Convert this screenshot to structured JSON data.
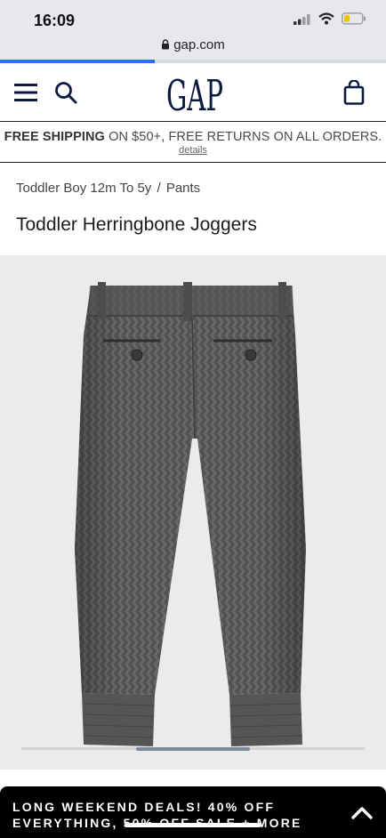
{
  "status_bar": {
    "time": "16:09",
    "icons": [
      "signal-icon",
      "wifi-icon",
      "battery-icon"
    ]
  },
  "browser": {
    "url": "gap.com",
    "load_progress": 0.4
  },
  "header": {
    "logo_text": "GAP",
    "icons": [
      "menu-icon",
      "search-icon",
      "shopping-bag-icon"
    ]
  },
  "promo": {
    "part1": "FREE SHIPPING",
    "part2": " ON $50+, ",
    "part3": "FREE RETURNS",
    "part4": " ON ALL ORDERS.",
    "details": "details"
  },
  "breadcrumb": {
    "category": "Toddler Boy 12m To 5y",
    "separator": "/",
    "subcategory": "Pants"
  },
  "product": {
    "title": "Toddler Herringbone Joggers",
    "image": "herringbone-joggers-image"
  },
  "carousel": {
    "position": 0.33
  },
  "banner": {
    "text": "LONG WEEKEND DEALS! 40% OFF EVERYTHING, 50% OFF SALE + MORE"
  },
  "colors": {
    "accent": "#2f6ef1",
    "logo": "#0b1b40",
    "fabric": "#5d5d5d",
    "banner_bg": "#000000"
  }
}
